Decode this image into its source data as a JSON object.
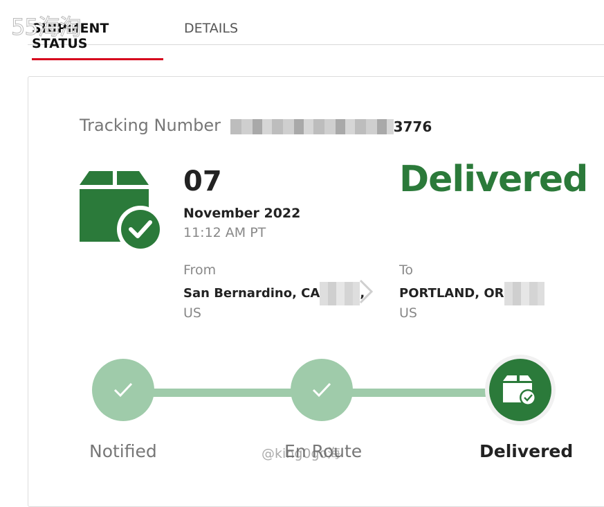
{
  "watermark_top": "55海淘",
  "watermark_bottom": "@king0go海",
  "tabs": [
    {
      "label": "SHIPMENT STATUS",
      "active": true
    },
    {
      "label": "DETAILS",
      "active": false
    }
  ],
  "tracking": {
    "label": "Tracking Number",
    "visible_suffix": "3776"
  },
  "delivery": {
    "day": "07",
    "month_year": "November 2022",
    "time": "11:12 AM PT",
    "status": "Delivered",
    "status_color": "#2b7a3a"
  },
  "from": {
    "label": "From",
    "city": "San Bernardino, CA",
    "trailing": ",",
    "country": "US"
  },
  "to": {
    "label": "To",
    "city": "PORTLAND, OR",
    "country": "US"
  },
  "progress": {
    "steps": [
      {
        "label": "Notified",
        "done": true
      },
      {
        "label": "En Route",
        "done": true
      },
      {
        "label": "Delivered",
        "current": true
      }
    ],
    "light_color": "#9fcbaa",
    "dark_color": "#2b7a3a"
  },
  "icons": {
    "delivered_package": "package-check-icon",
    "step_check": "check-icon",
    "route_arrow": "chevron-right-icon"
  }
}
